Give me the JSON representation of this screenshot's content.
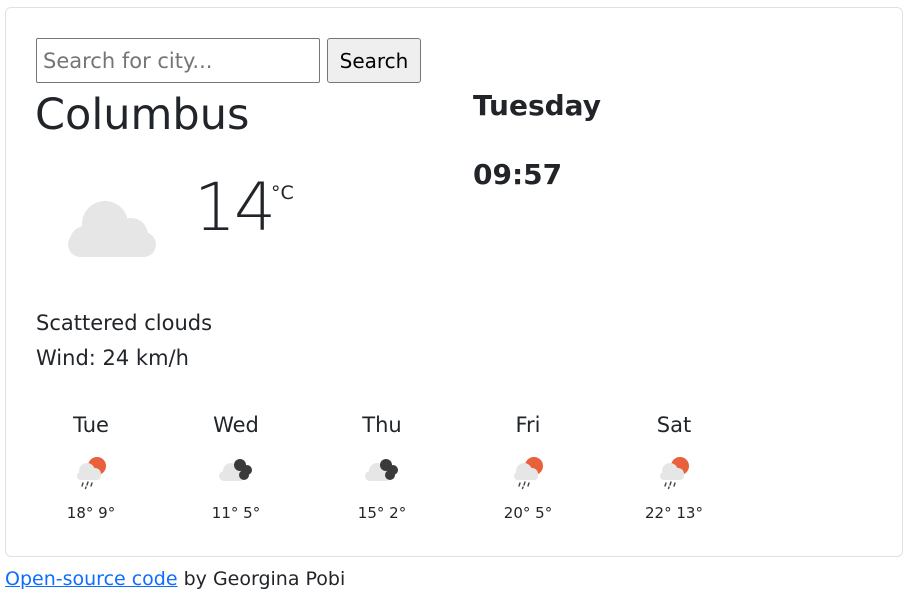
{
  "search": {
    "placeholder": "Search for city...",
    "value": "",
    "button_label": "Search"
  },
  "current": {
    "city": "Columbus",
    "temperature": "14",
    "unit": "°C",
    "icon": "cloud-icon",
    "description": "Scattered clouds",
    "wind_label": "Wind: ",
    "wind_value": "24 km/h",
    "day": "Tuesday",
    "time": "09:57"
  },
  "forecast": [
    {
      "day": "Tue",
      "high": "18°",
      "low": "9°",
      "icon": "sun-rain-icon"
    },
    {
      "day": "Wed",
      "high": "11°",
      "low": "5°",
      "icon": "dark-clouds-icon"
    },
    {
      "day": "Thu",
      "high": "15°",
      "low": "2°",
      "icon": "dark-clouds-icon"
    },
    {
      "day": "Fri",
      "high": "20°",
      "low": "5°",
      "icon": "sun-rain-icon"
    },
    {
      "day": "Sat",
      "high": "22°",
      "low": "13°",
      "icon": "sun-rain-icon"
    }
  ],
  "footer": {
    "link_text": "Open-source code",
    "suffix": " by Georgina Pobi"
  },
  "colors": {
    "link": "#0d6efd",
    "text": "#212529",
    "sun": "#e8603c",
    "light_cloud": "#e6e6e6",
    "dark_cloud": "#3a3a3a"
  }
}
